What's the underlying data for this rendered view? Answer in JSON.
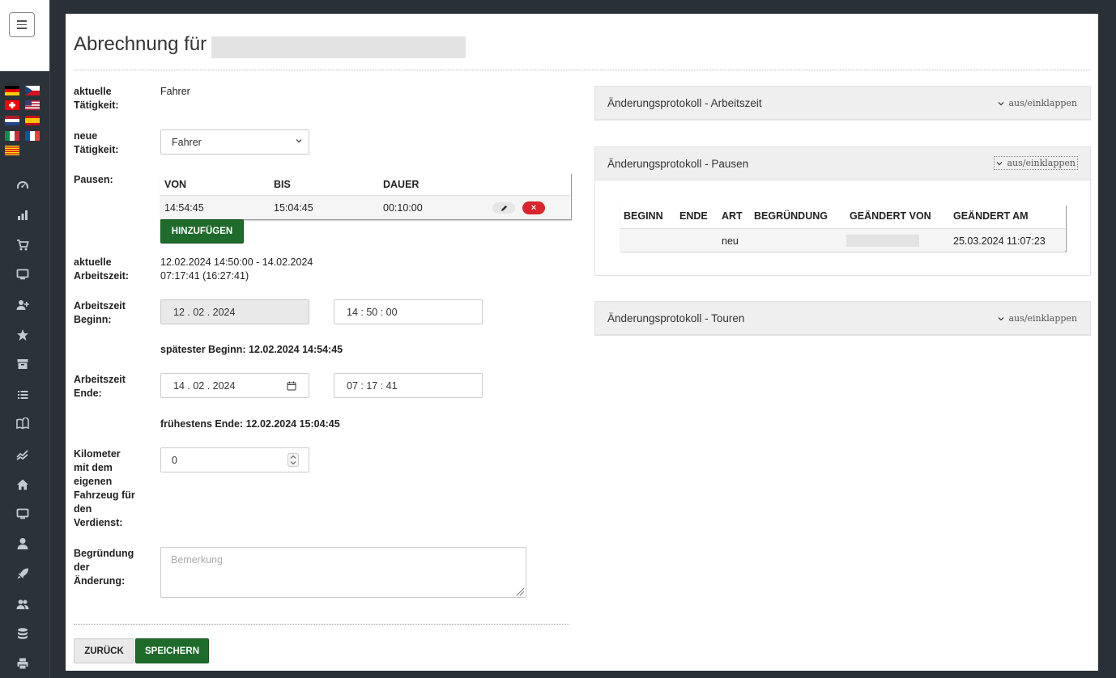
{
  "title": "Abrechnung für",
  "flags": [
    {
      "name": "de-flag-icon"
    },
    {
      "name": "cz-flag-icon"
    },
    {
      "name": "ch-flag-icon"
    },
    {
      "name": "us-flag-icon"
    },
    {
      "name": "nl-flag-icon"
    },
    {
      "name": "es-flag-icon"
    },
    {
      "name": "it-flag-icon"
    },
    {
      "name": "fr-flag-icon"
    },
    {
      "name": "ca-flag-icon"
    }
  ],
  "sidebar_icons": [
    "dashboard-icon",
    "chart-icon",
    "cart-icon",
    "monitor-icon",
    "add-user-icon",
    "star-icon",
    "archive-icon",
    "list-icon",
    "book-icon",
    "trend-icon",
    "home-icon",
    "desktop-icon",
    "user-icon",
    "rocket-icon",
    "users-icon",
    "database-icon",
    "printer-icon"
  ],
  "form": {
    "current_activity_label": "aktuelle Tätigkeit:",
    "current_activity_value": "Fahrer",
    "new_activity_label": "neue Tätigkeit:",
    "new_activity_value": "Fahrer",
    "pauses_label": "Pausen:",
    "pauses_headers": {
      "from": "VON",
      "to": "BIS",
      "duration": "DAUER"
    },
    "pauses_rows": [
      {
        "from": "14:54:45",
        "to": "15:04:45",
        "duration": "00:10:00"
      }
    ],
    "add_button": "HINZUFÜGEN",
    "current_worktime_label": "aktuelle Arbeitszeit:",
    "current_worktime_line1": "12.02.2024 14:50:00 - 14.02.2024",
    "current_worktime_line2": "07:17:41 (16:27:41)",
    "start_label": "Arbeitszeit Beginn:",
    "start_date": "12 . 02 . 2024",
    "start_time": "14 : 50 : 00",
    "latest_start": "spätester Beginn: 12.02.2024 14:54:45",
    "end_label": "Arbeitszeit Ende:",
    "end_date": "14 . 02 . 2024",
    "end_time": "07 : 17 : 41",
    "earliest_end": "frühestens Ende: 12.02.2024 15:04:45",
    "km_label": "Kilometer mit dem eigenen Fahrzeug für den Verdienst:",
    "km_value": "0",
    "reason_label": "Begründung der Änderung:",
    "reason_placeholder": "Bemerkung",
    "back_button": "ZURÜCK",
    "save_button": "SPEICHERN"
  },
  "panels": {
    "collapse_label": "aus/einklappen",
    "worktime_title": "Änderungsprotokoll - Arbeitszeit",
    "pauses_title": "Änderungsprotokoll - Pausen",
    "tours_title": "Änderungsprotokoll - Touren",
    "pauses_log_headers": {
      "begin": "BEGINN",
      "end": "ENDE",
      "type": "ART",
      "reason": "BEGRÜNDUNG",
      "changed_by": "GEÄNDERT VON",
      "changed_at": "GEÄNDERT AM"
    },
    "pauses_log_rows": [
      {
        "begin": "",
        "end": "",
        "type": "neu",
        "reason": "",
        "changed_at": "25.03.2024 11:07:23"
      }
    ]
  }
}
